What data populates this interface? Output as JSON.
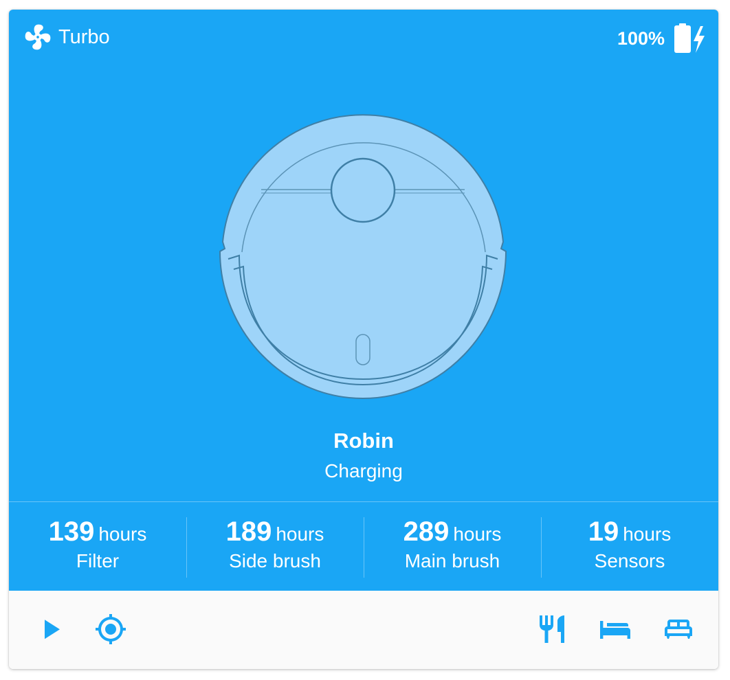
{
  "header": {
    "fan_mode": "Turbo",
    "fan_icon": "fan-icon",
    "battery_level": "100%",
    "battery_icon": "battery-charging-icon"
  },
  "vacuum": {
    "name": "Robin",
    "status": "Charging"
  },
  "stats": [
    {
      "value": "139",
      "unit": "hours",
      "label": "Filter"
    },
    {
      "value": "189",
      "unit": "hours",
      "label": "Side brush"
    },
    {
      "value": "289",
      "unit": "hours",
      "label": "Main brush"
    },
    {
      "value": "19",
      "unit": "hours",
      "label": "Sensors"
    }
  ],
  "toolbar": {
    "left": [
      "play-icon",
      "locate-icon"
    ],
    "right": [
      "silverware-icon",
      "bed-single-icon",
      "bed-double-icon"
    ]
  },
  "colors": {
    "primary": "#1aa6f5",
    "robot_fill": "#9ed4f9",
    "robot_stroke": "#3f7fa6",
    "toolbar_bg": "#fafafa"
  }
}
